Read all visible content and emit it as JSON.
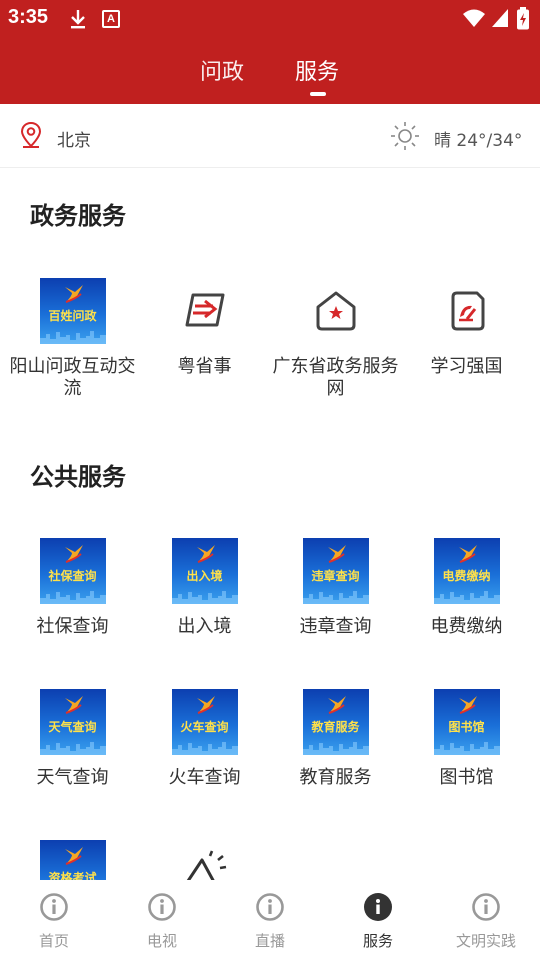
{
  "status_bar": {
    "time": "3:35",
    "icons": [
      "download-icon",
      "a-icon",
      "wifi-icon",
      "signal-icon",
      "battery-icon"
    ]
  },
  "header": {
    "tabs": [
      {
        "label": "问政",
        "active": false
      },
      {
        "label": "服务",
        "active": true
      }
    ],
    "color": "#c0201f"
  },
  "location": {
    "city": "北京",
    "weather": "晴 24°/34°",
    "icons": [
      "location-pin-icon",
      "sun-icon"
    ]
  },
  "sections": {
    "gov": {
      "title": "政务服务",
      "items": [
        {
          "label": "阳山问政互动交流",
          "tile_text": "百姓问政",
          "kind": "tile"
        },
        {
          "label": "粤省事",
          "icon": "yue-sheng-shi-icon",
          "kind": "icon"
        },
        {
          "label": "广东省政务服务网",
          "icon": "house-star-icon",
          "kind": "icon"
        },
        {
          "label": "学习强国",
          "icon": "party-emblem-icon",
          "kind": "icon"
        }
      ]
    },
    "public": {
      "title": "公共服务",
      "items": [
        {
          "label": "社保查询",
          "tile_text": "社保查询"
        },
        {
          "label": "出入境",
          "tile_text": "出入境"
        },
        {
          "label": "违章查询",
          "tile_text": "违章查询"
        },
        {
          "label": "电费缴纳",
          "tile_text": "电费缴纳"
        },
        {
          "label": "天气查询",
          "tile_text": "天气查询"
        },
        {
          "label": "火车查询",
          "tile_text": "火车查询"
        },
        {
          "label": "教育服务",
          "tile_text": "教育服务"
        },
        {
          "label": "图书馆",
          "tile_text": "图书馆"
        },
        {
          "tile_text": "资格考试"
        },
        {
          "icon": "megaphone-icon"
        }
      ]
    }
  },
  "bottom_nav": {
    "items": [
      {
        "label": "首页",
        "icon": "info-icon"
      },
      {
        "label": "电视",
        "icon": "info-icon"
      },
      {
        "label": "直播",
        "icon": "info-icon"
      },
      {
        "label": "服务",
        "icon": "info-icon",
        "active": true
      },
      {
        "label": "文明实践",
        "icon": "info-icon"
      }
    ]
  },
  "colors": {
    "brand_red": "#c0201f",
    "tile_blue": "#1a6fd8",
    "tile_text_yellow": "#ffe14a"
  }
}
